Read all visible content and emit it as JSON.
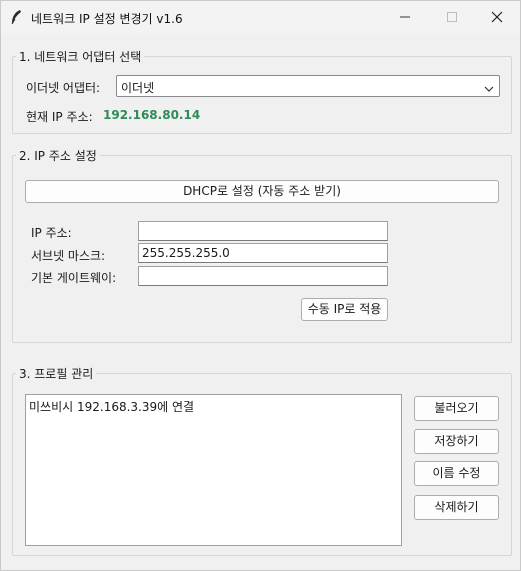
{
  "window": {
    "title": "네트워크 IP 설정 변경기 v1.6"
  },
  "adapter_section": {
    "title": "1. 네트워크 어댑터 선택",
    "adapter_label": "이더넷 어댑터:",
    "adapter_selected": "이더넷",
    "current_ip_label": "현재 IP 주소:",
    "current_ip_value": "192.168.80.14",
    "current_ip_color": "#2e8b57"
  },
  "ip_section": {
    "title": "2. IP 주소 설정",
    "dhcp_button": "DHCP로 설정 (자동 주소 받기)",
    "ip_label": "IP 주소:",
    "ip_value": "",
    "subnet_label": "서브넷 마스크:",
    "subnet_value": "255.255.255.0",
    "gateway_label": "기본 게이트웨이:",
    "gateway_value": "",
    "apply_button": "수동 IP로 적용"
  },
  "profile_section": {
    "title": "3. 프로필 관리",
    "profiles": [
      "미쓰비시 192.168.3.39에 연결"
    ],
    "load_button": "불러오기",
    "save_button": "저장하기",
    "rename_button": "이름 수정",
    "delete_button": "삭제하기"
  }
}
